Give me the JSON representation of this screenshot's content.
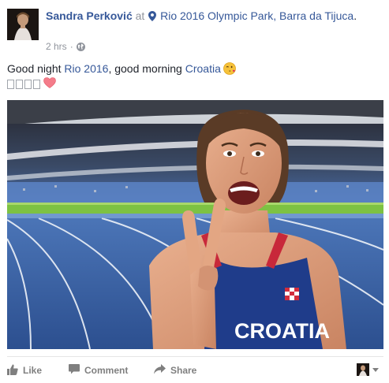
{
  "post": {
    "author": "Sandra Perković",
    "at_word": "at",
    "place": "Rio 2016 Olympic Park, Barra da Tijuca",
    "place_suffix": ".",
    "time": "2 hrs",
    "privacy_icon": "globe-icon",
    "text": {
      "part1": "Good night ",
      "hashtag1": "Rio 2016",
      "part2": ", good morning ",
      "hashtag2": "Croatia",
      "emoji": "winking-face-kiss",
      "second_line_glyphs": [
        "□",
        "□",
        "□",
        "□"
      ],
      "second_line_emoji": "heart-icon"
    },
    "photo": {
      "jersey_text": "CROATIA"
    }
  },
  "actions": {
    "like": "Like",
    "comment": "Comment",
    "share": "Share"
  },
  "colors": {
    "link": "#365899",
    "meta": "#90949c",
    "action": "#7f7f7f",
    "text": "#1d2129"
  }
}
